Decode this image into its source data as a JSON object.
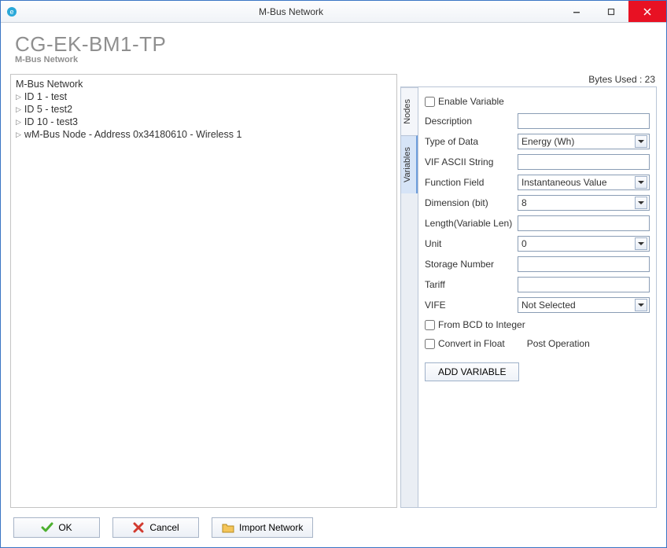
{
  "window": {
    "title": "M-Bus Network"
  },
  "header": {
    "title": "CG-EK-BM1-TP",
    "subtitle": "M-Bus Network"
  },
  "bytes_used_label": "Bytes Used : 23",
  "tree": {
    "root": "M-Bus Network",
    "items": [
      "ID 1 - test",
      "ID 5 - test2",
      "ID 10 - test3",
      "wM-Bus Node - Address 0x34180610 - Wireless 1"
    ]
  },
  "tabs": {
    "nodes": "Nodes",
    "variables": "Variables"
  },
  "form": {
    "enable_variable_label": "Enable Variable",
    "description_label": "Description",
    "description_value": "",
    "type_of_data_label": "Type of Data",
    "type_of_data_value": "Energy (Wh)",
    "vif_ascii_label": "VIF ASCII String",
    "vif_ascii_value": "",
    "function_field_label": "Function Field",
    "function_field_value": "Instantaneous Value",
    "dimension_label": "Dimension (bit)",
    "dimension_value": "8",
    "length_label": "Length(Variable Len)",
    "length_value": "",
    "unit_label": "Unit",
    "unit_value": "0",
    "storage_number_label": "Storage Number",
    "storage_number_value": "",
    "tariff_label": "Tariff",
    "tariff_value": "",
    "vife_label": "VIFE",
    "vife_value": "Not Selected",
    "from_bcd_label": "From BCD to Integer",
    "convert_float_label": "Convert in Float",
    "post_operation_label": "Post Operation",
    "add_variable_label": "ADD VARIABLE"
  },
  "footer": {
    "ok": "OK",
    "cancel": "Cancel",
    "import_network": "Import Network"
  }
}
